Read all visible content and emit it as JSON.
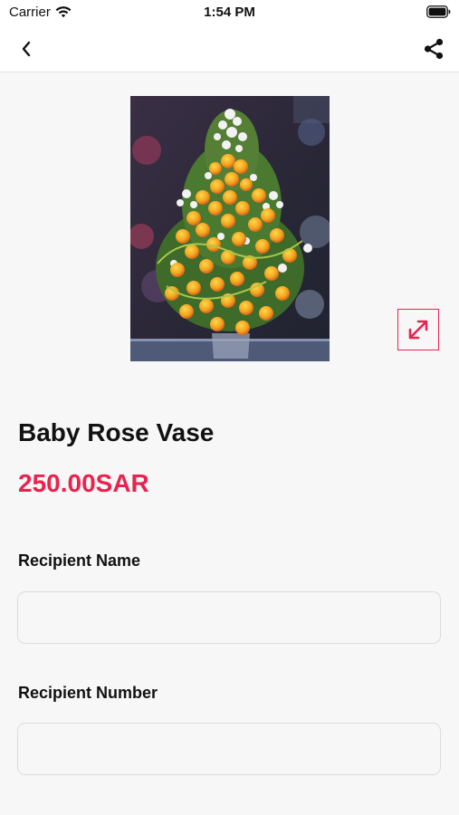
{
  "status_bar": {
    "carrier": "Carrier",
    "time": "1:54 PM"
  },
  "nav": {
    "back_icon": "chevron-left-icon",
    "share_icon": "share-icon"
  },
  "product": {
    "title": "Baby Rose Vase",
    "price": "250.00SAR",
    "expand_icon": "expand-arrows-icon"
  },
  "form": {
    "recipient_name_label": "Recipient Name",
    "recipient_name_value": "",
    "recipient_number_label": "Recipient Number",
    "recipient_number_value": ""
  },
  "colors": {
    "accent": "#e8234f",
    "background": "#f7f7f7",
    "nav_background": "#ffffff"
  }
}
